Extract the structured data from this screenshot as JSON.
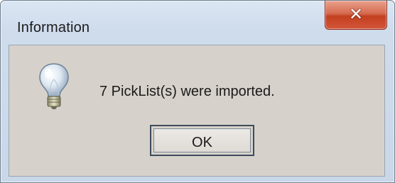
{
  "window": {
    "title": "Information",
    "close_icon": "close-icon"
  },
  "dialog": {
    "icon": "lightbulb-icon",
    "message": "7 PickList(s) were imported.",
    "ok_label": "OK"
  },
  "colors": {
    "title_bar": "#cfdcec",
    "content_background": "#d6d2cb",
    "close_button": "#c2401f"
  }
}
